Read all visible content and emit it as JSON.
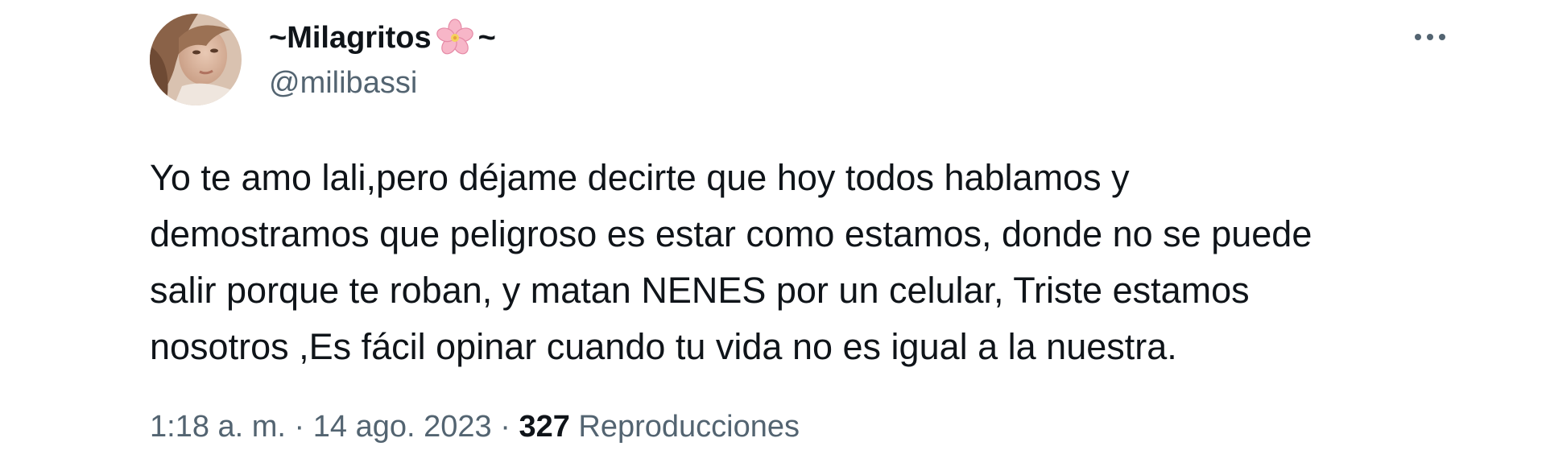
{
  "author": {
    "display_name_prefix": "~Milagritos",
    "display_name_suffix": "~",
    "emoji_icon": "cherry-blossom-icon",
    "handle": "@milibassi",
    "avatar_icon": "profile-photo"
  },
  "tweet": {
    "text_lines": [
      "Yo te amo lali,pero déjame decirte que hoy todos hablamos y",
      "demostramos que peligroso es estar como estamos, donde no se puede",
      "salir porque te roban, y matan NENES por un celular, Triste estamos",
      "nosotros ,Es fácil opinar cuando tu vida no es igual a la nuestra."
    ]
  },
  "meta": {
    "time": "1:18 a. m.",
    "separator": " · ",
    "date": "14 ago. 2023",
    "views_count": "327",
    "views_label": " Reproducciones"
  },
  "colors": {
    "text_primary": "#0f1419",
    "text_secondary": "#536471",
    "background": "#ffffff"
  },
  "icons": {
    "more": "more-options-icon"
  }
}
